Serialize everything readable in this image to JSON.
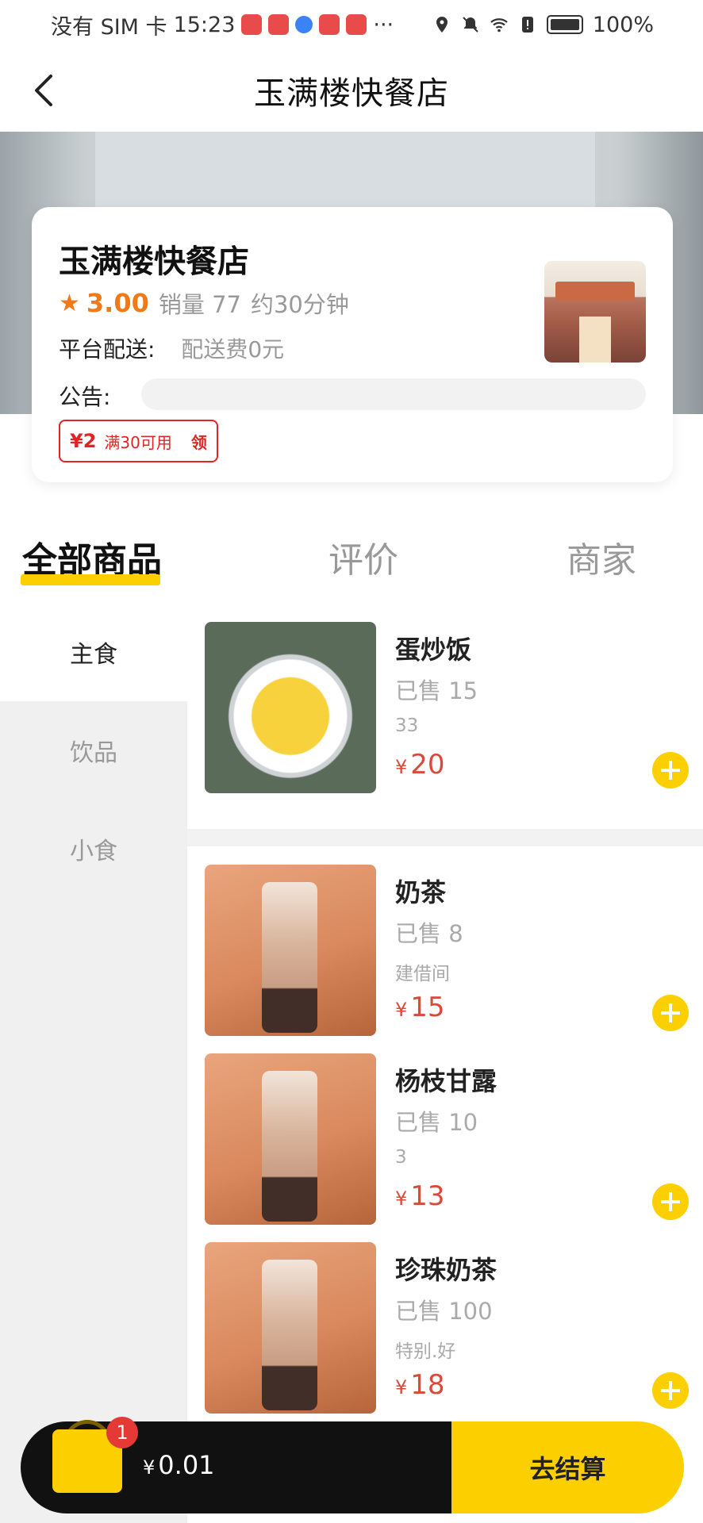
{
  "status_bar": {
    "carrier": "没有 SIM 卡",
    "time": "15:23",
    "more": "···",
    "battery": "100%"
  },
  "header": {
    "title": "玉满楼快餐店"
  },
  "shop": {
    "name": "玉满楼快餐店",
    "rating": "3.00",
    "sales": "销量 77",
    "eta": "约30分钟",
    "delivery_label": "平台配送:",
    "delivery_fee": "配送费0元",
    "notice_label": "公告:",
    "coupon": {
      "amount": "¥2",
      "condition": "满30可用",
      "action": "领"
    }
  },
  "tabs": [
    "全部商品",
    "评价",
    "商家"
  ],
  "categories": [
    "主食",
    "饮品",
    "小食"
  ],
  "products": [
    {
      "name": "蛋炒饭",
      "sold": "已售 15",
      "desc": "33",
      "price": "20"
    },
    {
      "name": "奶茶",
      "sold": "已售 8",
      "desc": "建借间",
      "price": "15"
    },
    {
      "name": "杨枝甘露",
      "sold": "已售 10",
      "desc": "3",
      "price": "13"
    },
    {
      "name": "珍珠奶茶",
      "sold": "已售 100",
      "desc": "特别.好",
      "price": "18"
    }
  ],
  "currency": "¥",
  "cart": {
    "count": "1",
    "total": "0.01",
    "checkout_label": "去结算"
  },
  "colors": {
    "accent": "#fcd000",
    "price": "#d94a3a",
    "rating": "#f07a1a",
    "coupon": "#e02424"
  }
}
